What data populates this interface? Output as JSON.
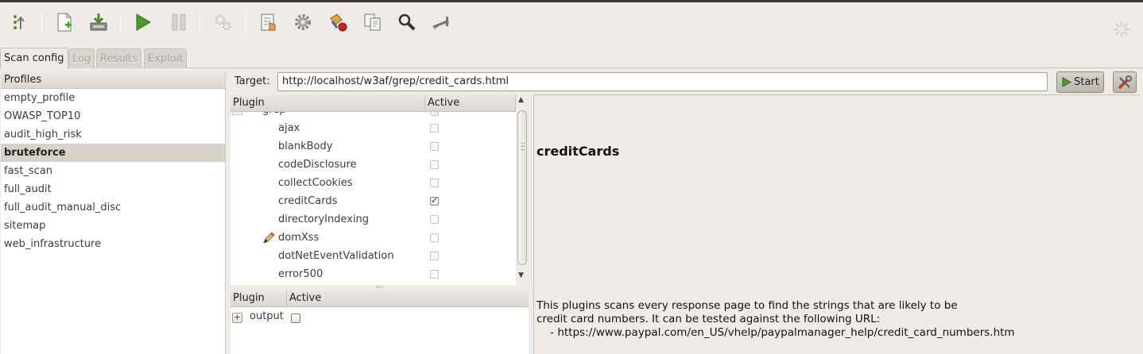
{
  "toolbar": {
    "buttons": [
      {
        "name": "wizard-icon"
      },
      {
        "name": "new-profile-icon"
      },
      {
        "name": "save-profile-icon"
      },
      {
        "name": "play-icon"
      },
      {
        "name": "pause-icon"
      },
      {
        "name": "gears-disabled-icon"
      },
      {
        "name": "manual-request-icon"
      },
      {
        "name": "settings-gear-icon"
      },
      {
        "name": "fuzzy-request-icon"
      },
      {
        "name": "compare-icon"
      },
      {
        "name": "encode-decode-icon"
      },
      {
        "name": "proxy-icon"
      }
    ]
  },
  "tabs": [
    {
      "label": "Scan config",
      "active": true
    },
    {
      "label": "Log",
      "active": false
    },
    {
      "label": "Results",
      "active": false
    },
    {
      "label": "Exploit",
      "active": false
    }
  ],
  "profiles": {
    "header": "Profiles",
    "items": [
      "empty_profile",
      "OWASP_TOP10",
      "audit_high_risk",
      "bruteforce",
      "fast_scan",
      "full_audit",
      "full_audit_manual_disc",
      "sitemap",
      "web_infrastructure"
    ],
    "selected": "bruteforce"
  },
  "target": {
    "label": "Target:",
    "value": "http://localhost/w3af/grep/credit_cards.html",
    "start_label": "Start"
  },
  "plugin_tree": {
    "col_plugin": "Plugin",
    "col_active": "Active",
    "group_partial": "grep",
    "rows": [
      {
        "name": "ajax",
        "checked": false
      },
      {
        "name": "blankBody",
        "checked": false
      },
      {
        "name": "codeDisclosure",
        "checked": false
      },
      {
        "name": "collectCookies",
        "checked": false
      },
      {
        "name": "creditCards",
        "checked": true
      },
      {
        "name": "directoryIndexing",
        "checked": false
      },
      {
        "name": "domXss",
        "checked": false,
        "edited": true
      },
      {
        "name": "dotNetEventValidation",
        "checked": false
      },
      {
        "name": "error500",
        "checked": false
      }
    ]
  },
  "output_tree": {
    "col_plugin": "Plugin",
    "col_active": "Active",
    "expander": "+",
    "group": "output",
    "checked": false
  },
  "description": {
    "title": "creditCards",
    "line1": "This plugins scans every response page to find the strings that are likely to be",
    "line2": "credit card numbers. It can be tested against the following URL:",
    "line3": "    - https://www.paypal.com/en_US/vhelp/paypalmanager_help/credit_card_numbers.htm"
  },
  "colors": {
    "background": "#efebe7",
    "selected_row": "#d9d2c9",
    "play_green": "#4a9c2a"
  }
}
